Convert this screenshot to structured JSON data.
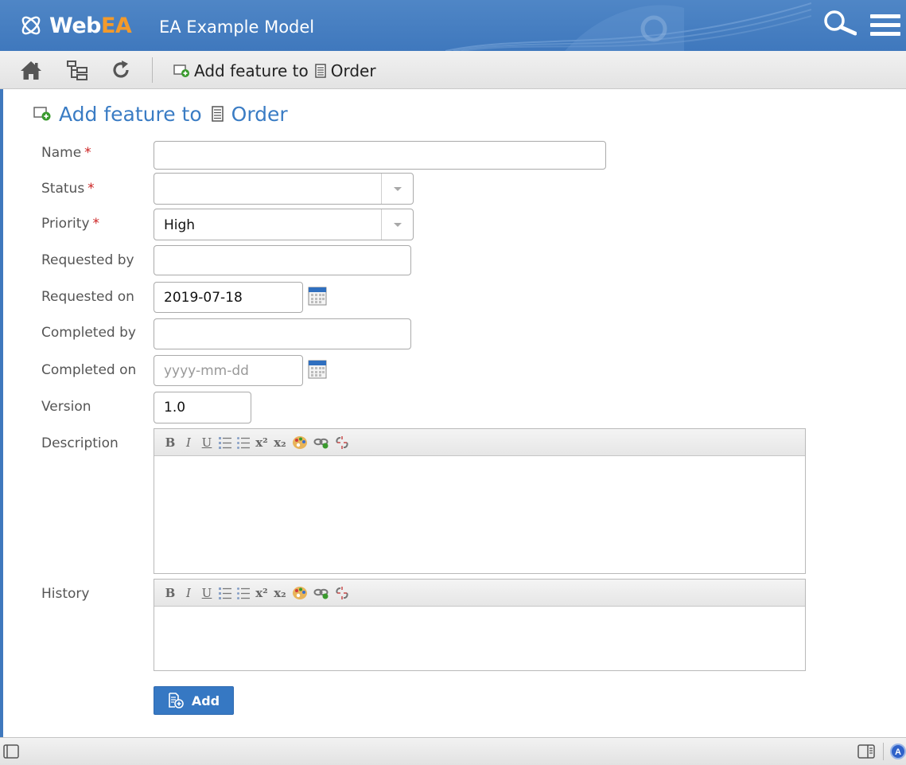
{
  "app": {
    "logo_text_web": "Web",
    "logo_text_ea": "EA",
    "model_name": "EA Example Model"
  },
  "toolbar": {
    "home_icon": "home-icon",
    "tree_icon": "tree-icon",
    "refresh_icon": "refresh-icon",
    "crumb_action": "Add feature to",
    "crumb_target": "Order"
  },
  "page": {
    "title_action": "Add feature to",
    "title_target": "Order"
  },
  "form": {
    "name": {
      "label": "Name",
      "required": "*",
      "value": ""
    },
    "status": {
      "label": "Status",
      "required": "*",
      "value": ""
    },
    "priority": {
      "label": "Priority",
      "required": "*",
      "value": "High"
    },
    "requested_by": {
      "label": "Requested by",
      "value": ""
    },
    "requested_on": {
      "label": "Requested on",
      "value": "2019-07-18"
    },
    "completed_by": {
      "label": "Completed by",
      "value": ""
    },
    "completed_on": {
      "label": "Completed on",
      "value": "",
      "placeholder": "yyyy-mm-dd"
    },
    "version": {
      "label": "Version",
      "value": "1.0"
    },
    "description": {
      "label": "Description",
      "value": ""
    },
    "history": {
      "label": "History",
      "value": ""
    },
    "add_button": "Add"
  },
  "editor_buttons": {
    "bold": "B",
    "italic": "I",
    "underline": "U",
    "superscript": "x²",
    "subscript": "x₂"
  },
  "colors": {
    "header_blue": "#3f78bd",
    "title_blue": "#3a7cc4",
    "logo_orange": "#f39a2b",
    "required_red": "#cc2222",
    "add_button_blue": "#3678c3"
  }
}
